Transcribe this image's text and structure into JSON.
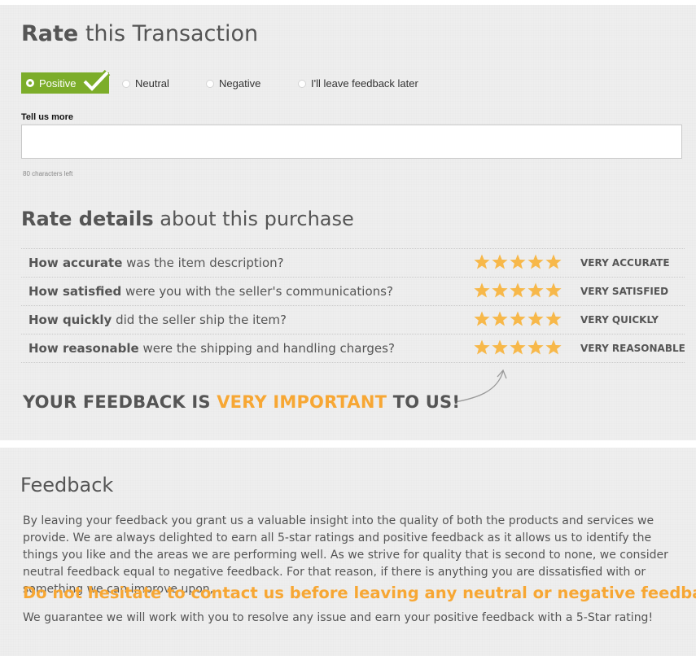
{
  "rate_transaction": {
    "title_bold": "Rate",
    "title_rest": " this Transaction",
    "options": [
      {
        "label": "Positive",
        "selected": true
      },
      {
        "label": "Neutral",
        "selected": false
      },
      {
        "label": "Negative",
        "selected": false
      },
      {
        "label": "I'll leave feedback later",
        "selected": false
      }
    ],
    "tell_us_more_label": "Tell us more",
    "tell_us_more_value": "",
    "chars_left": "80 characters left"
  },
  "rate_details": {
    "title_bold": "Rate details",
    "title_rest": " about this purchase",
    "rows": [
      {
        "q_bold": "How accurate",
        "q_rest": " was the item description?",
        "stars": 5,
        "value": "VERY ACCURATE"
      },
      {
        "q_bold": "How satisfied",
        "q_rest": " were you with the seller's communications?",
        "stars": 5,
        "value": "VERY SATISFIED"
      },
      {
        "q_bold": "How quickly",
        "q_rest": " did the seller ship the item?",
        "stars": 5,
        "value": "VERY QUICKLY"
      },
      {
        "q_bold": "How reasonable",
        "q_rest": " were the shipping and handling charges?",
        "stars": 5,
        "value": "VERY REASONABLE"
      }
    ],
    "important_part1": "YOUR FEEDBACK IS ",
    "important_highlight": "VERY IMPORTANT",
    "important_part2": " TO US!"
  },
  "feedback": {
    "title": "Feedback",
    "paragraph1": "By leaving your feedback you grant us a valuable insight into the quality of both the products and services we provide. We are always delighted to earn all 5-star ratings and positive feedback as it allows us to identify the things you like and the areas we are performing well. As we strive for quality that is second to none, we consider neutral feedback equal to negative feedback. For that reason, if there is anything you are dissatisfied with or something we can improve upon,",
    "highlight": "Do not hesitate to contact us before leaving any neutral or negative feedback.",
    "paragraph2": "We guarantee we will work with you to resolve any issue and earn your positive feedback with a 5-Star rating!"
  },
  "colors": {
    "positive_green": "#7cad2a",
    "star_orange": "#f7b84a",
    "highlight_orange": "#f7a734"
  },
  "icons": [
    "check-icon",
    "star-icon",
    "curved-arrow-icon",
    "radio-icon"
  ]
}
